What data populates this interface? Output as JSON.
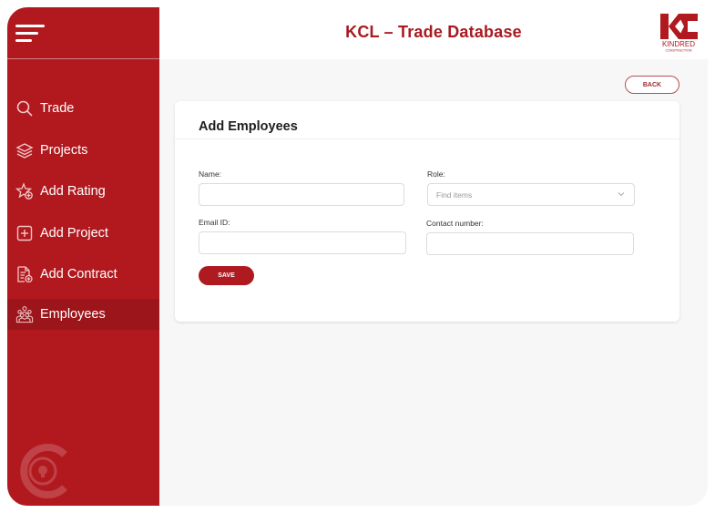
{
  "header": {
    "title": "KCL – Trade Database",
    "logo": {
      "initials": "KC",
      "name": "KINDRED",
      "sub": "CONSTRUCTION"
    }
  },
  "sidebar": {
    "menu_icon": "hamburger-menu-icon",
    "items": [
      {
        "label": "Trade",
        "icon": "search-icon",
        "active": false
      },
      {
        "label": "Projects",
        "icon": "layers-icon",
        "active": false
      },
      {
        "label": "Add Rating",
        "icon": "star-add-icon",
        "active": false
      },
      {
        "label": "Add Project",
        "icon": "plus-square-icon",
        "active": false
      },
      {
        "label": "Add Contract",
        "icon": "document-add-icon",
        "active": false
      },
      {
        "label": "Employees",
        "icon": "employees-group-icon",
        "active": true
      }
    ]
  },
  "actions": {
    "back_label": "BACK"
  },
  "form": {
    "title": "Add Employees",
    "fields": {
      "name": {
        "label": "Name:",
        "value": ""
      },
      "role": {
        "label": "Role:",
        "placeholder": "Find items",
        "value": ""
      },
      "email": {
        "label": "Email ID:",
        "value": ""
      },
      "contact": {
        "label": "Contact number:",
        "value": ""
      }
    },
    "save_label": "SAVE"
  },
  "colors": {
    "brand": "#b1191f",
    "background": "#f7f7f7"
  }
}
